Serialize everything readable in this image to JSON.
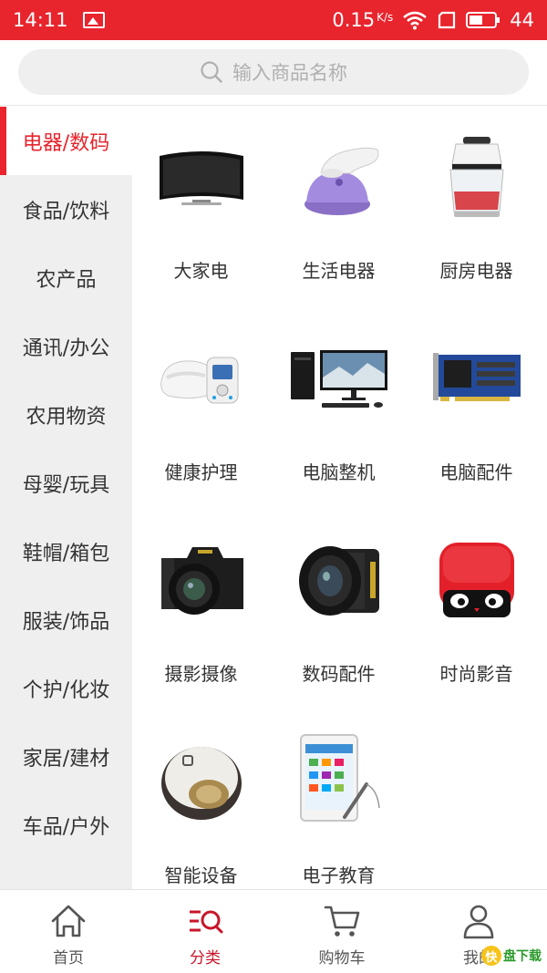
{
  "status_bar": {
    "time": "14:11",
    "speed": "0.15",
    "speed_unit": "K/s",
    "battery": "44",
    "color": "#e8242d"
  },
  "search": {
    "placeholder": "输入商品名称"
  },
  "sidebar": {
    "items": [
      {
        "label": "电器/数码",
        "active": true
      },
      {
        "label": "食品/饮料"
      },
      {
        "label": "农产品"
      },
      {
        "label": "通讯/办公"
      },
      {
        "label": "农用物资"
      },
      {
        "label": "母婴/玩具"
      },
      {
        "label": "鞋帽/箱包"
      },
      {
        "label": "服装/饰品"
      },
      {
        "label": "个护/化妆"
      },
      {
        "label": "家居/建材"
      },
      {
        "label": "车品/户外"
      }
    ]
  },
  "categories": [
    {
      "label": "大家电",
      "icon": "tv-icon"
    },
    {
      "label": "生活电器",
      "icon": "lint-remover-icon"
    },
    {
      "label": "厨房电器",
      "icon": "food-chopper-icon"
    },
    {
      "label": "健康护理",
      "icon": "neck-massager-icon"
    },
    {
      "label": "电脑整机",
      "icon": "desktop-computer-icon"
    },
    {
      "label": "电脑配件",
      "icon": "graphics-card-icon"
    },
    {
      "label": "摄影摄像",
      "icon": "dslr-camera-icon"
    },
    {
      "label": "数码配件",
      "icon": "camera-lens-icon"
    },
    {
      "label": "时尚影音",
      "icon": "speaker-icon"
    },
    {
      "label": "智能设备",
      "icon": "robot-vacuum-icon"
    },
    {
      "label": "电子教育",
      "icon": "learning-tablet-icon"
    }
  ],
  "bottom_nav": [
    {
      "label": "首页",
      "icon": "home-icon"
    },
    {
      "label": "分类",
      "icon": "category-icon",
      "active": true
    },
    {
      "label": "购物车",
      "icon": "cart-icon"
    },
    {
      "label": "我的",
      "icon": "user-icon"
    }
  ],
  "watermark": {
    "text": "盘下载",
    "badge": "快"
  },
  "colors": {
    "accent": "#e8242d",
    "active_nav": "#c8162b"
  }
}
